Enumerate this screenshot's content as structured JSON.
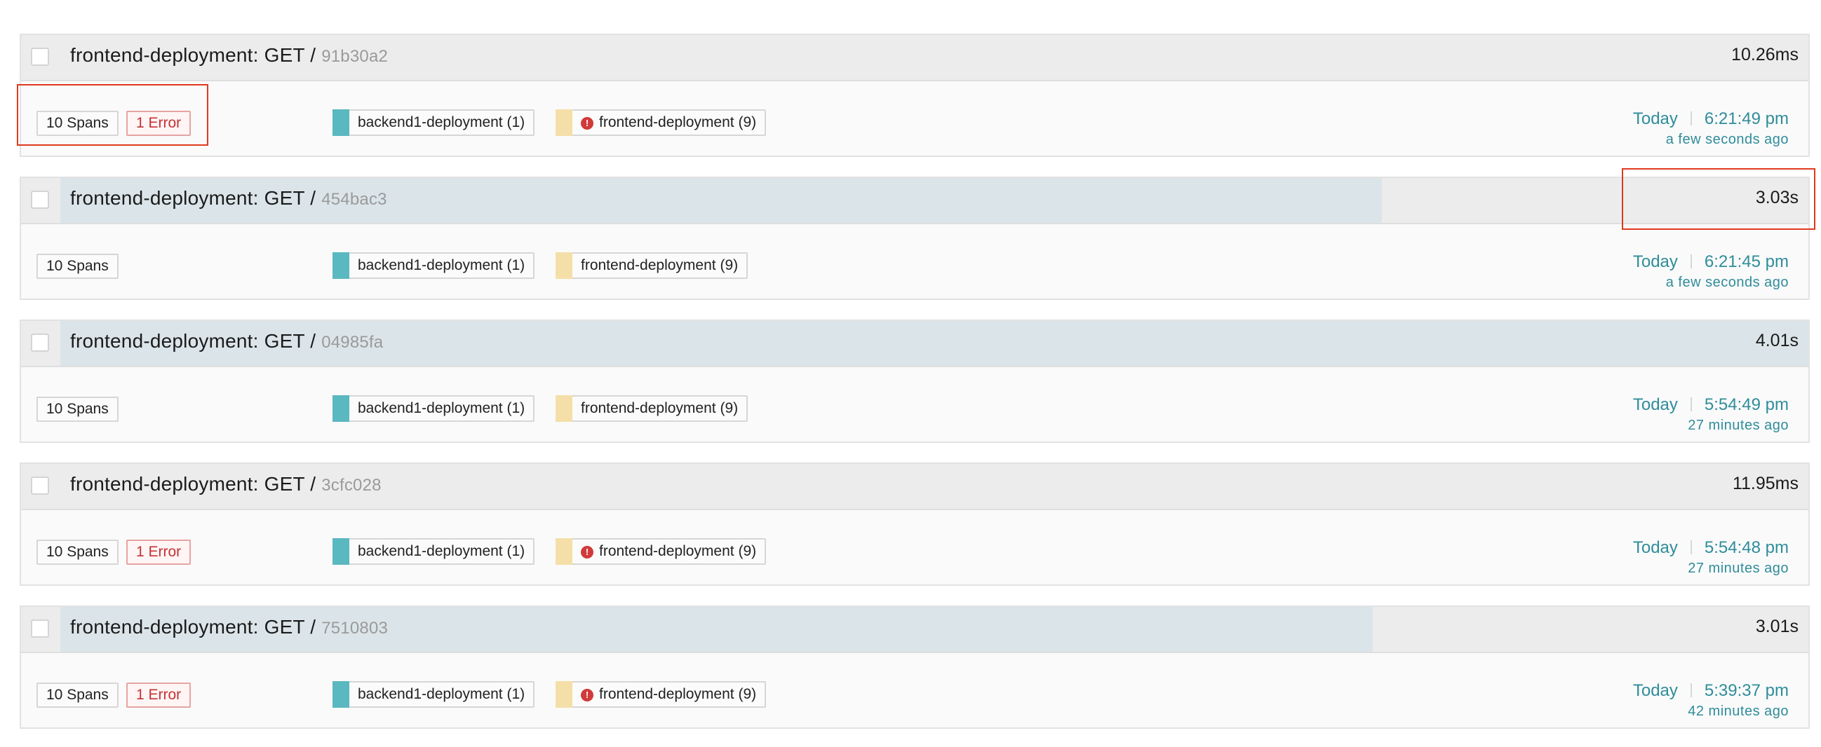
{
  "traces": [
    {
      "title": "frontend-deployment: GET /",
      "trace_id": "91b30a2",
      "duration": "10.26ms",
      "duration_fraction": 0.0,
      "spans": "10 Spans",
      "error": "1 Error",
      "services": [
        {
          "name": "backend1-deployment (1)",
          "color": "#5ab8c0",
          "has_error": false
        },
        {
          "name": "frontend-deployment (9)",
          "color": "#f5dfa8",
          "has_error": true
        }
      ],
      "date": "Today",
      "time": "6:21:49 pm",
      "ago": "a few seconds ago"
    },
    {
      "title": "frontend-deployment: GET /",
      "trace_id": "454bac3",
      "duration": "3.03s",
      "duration_fraction": 0.756,
      "spans": "10 Spans",
      "error": null,
      "services": [
        {
          "name": "backend1-deployment (1)",
          "color": "#5ab8c0",
          "has_error": false
        },
        {
          "name": "frontend-deployment (9)",
          "color": "#f5dfa8",
          "has_error": false
        }
      ],
      "date": "Today",
      "time": "6:21:45 pm",
      "ago": "a few seconds ago"
    },
    {
      "title": "frontend-deployment: GET /",
      "trace_id": "04985fa",
      "duration": "4.01s",
      "duration_fraction": 1.0,
      "spans": "10 Spans",
      "error": null,
      "services": [
        {
          "name": "backend1-deployment (1)",
          "color": "#5ab8c0",
          "has_error": false
        },
        {
          "name": "frontend-deployment (9)",
          "color": "#f5dfa8",
          "has_error": false
        }
      ],
      "date": "Today",
      "time": "5:54:49 pm",
      "ago": "27 minutes ago"
    },
    {
      "title": "frontend-deployment: GET /",
      "trace_id": "3cfc028",
      "duration": "11.95ms",
      "duration_fraction": 0.0,
      "spans": "10 Spans",
      "error": "1 Error",
      "services": [
        {
          "name": "backend1-deployment (1)",
          "color": "#5ab8c0",
          "has_error": false
        },
        {
          "name": "frontend-deployment (9)",
          "color": "#f5dfa8",
          "has_error": true
        }
      ],
      "date": "Today",
      "time": "5:54:48 pm",
      "ago": "27 minutes ago"
    },
    {
      "title": "frontend-deployment: GET /",
      "trace_id": "7510803",
      "duration": "3.01s",
      "duration_fraction": 0.751,
      "spans": "10 Spans",
      "error": "1 Error",
      "services": [
        {
          "name": "backend1-deployment (1)",
          "color": "#5ab8c0",
          "has_error": false
        },
        {
          "name": "frontend-deployment (9)",
          "color": "#f5dfa8",
          "has_error": true
        }
      ],
      "date": "Today",
      "time": "5:39:37 pm",
      "ago": "42 minutes ago"
    }
  ],
  "colors": {
    "accent": "#2f8d9a",
    "error": "#c43333",
    "annotation": "#e0391e"
  }
}
